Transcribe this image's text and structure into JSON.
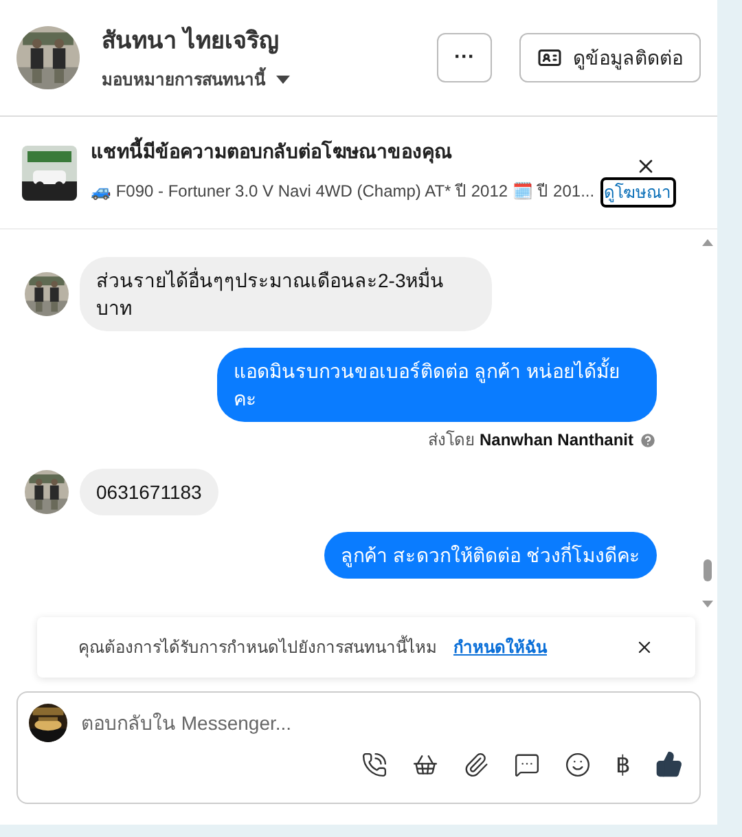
{
  "header": {
    "name": "สันทนา ไทยเจริญ",
    "assign": "มอบหมายการสนทนานี้",
    "more": "···",
    "contact_button": "ดูข้อมูลติดต่อ"
  },
  "ad": {
    "title": "แชทนี้มีข้อความตอบกลับต่อโฆษณาของคุณ",
    "detail": "🚙 F090 - Fortuner 3.0 V Navi 4WD (Champ) AT* ปี 2012 🗓️ ปี 201...",
    "link": "ดูโฆษณา"
  },
  "messages": [
    {
      "kind": "incoming",
      "text": "ส่วนรายได้อื่นๆๆประมาณเดือนละ2-3หมื่นบาท"
    },
    {
      "kind": "outgoing",
      "text": "แอดมินรบกวนขอเบอร์ติดต่อ ลูกค้า  หน่อยได้มั้ยคะ",
      "sent_by_label": "ส่งโดย",
      "sender": "Nanwhan Nanthanit"
    },
    {
      "kind": "incoming",
      "text": "0631671183"
    },
    {
      "kind": "outgoing",
      "text": "ลูกค้า   สะดวกให้ติดต่อ ช่วงกี่โมงดีคะ"
    }
  ],
  "notice": {
    "text": "คุณต้องการได้รับการกำหนดไปยังการสนทนานี้ไหม",
    "link": "กำหนดให้ฉัน"
  },
  "composer": {
    "placeholder": "ตอบกลับใน Messenger...",
    "currency": "฿"
  }
}
